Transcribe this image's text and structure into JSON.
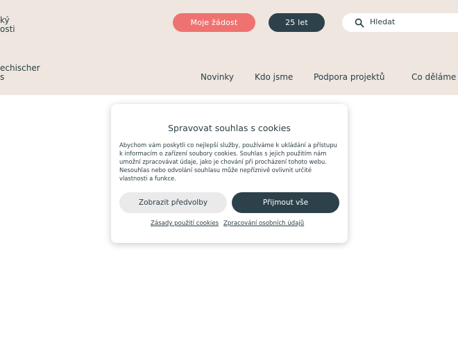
{
  "header": {
    "logo_lines": [
      "ký",
      "osti",
      "echischer",
      "s"
    ],
    "request_button": "Moje žádost",
    "anniversary_button": "25 let",
    "search": {
      "label": "Hledat"
    }
  },
  "nav": {
    "items": [
      "Novinky",
      "Kdo jsme",
      "Podpora projektů",
      "Co děláme"
    ]
  },
  "cookie_modal": {
    "title": "Spravovat souhlas s cookies",
    "text": "Abychom vám poskytli co nejlepší služby, používáme k ukládání a přístupu k informacím o zařízení soubory cookies. Souhlas s jejich použitím nám umožní zpracovávat údaje, jako je chování při procházení tohoto webu. Nesouhlas nebo odvolání souhlasu může nepříznivě ovlivnit určité vlastnosti a funkce.",
    "preferences_button": "Zobrazit předvolby",
    "accept_button": "Přijmout vše",
    "links": [
      "Zásady použití cookies",
      "Zpracování osobních údajů"
    ]
  },
  "colors": {
    "header_bg": "#eee6df",
    "accent": "#ee7370",
    "dark": "#2d414b"
  }
}
